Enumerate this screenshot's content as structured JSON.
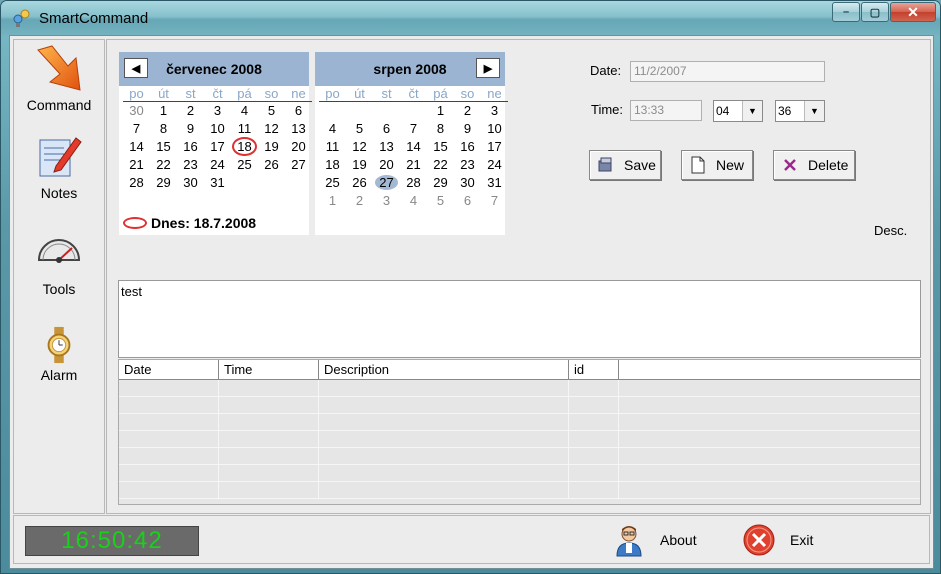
{
  "window": {
    "title": "SmartCommand",
    "minimize": "–",
    "maximize": "▢",
    "close": "✕"
  },
  "nav": [
    {
      "label": "Command",
      "icon": "arrow-icon"
    },
    {
      "label": "Notes",
      "icon": "notes-icon"
    },
    {
      "label": "Tools",
      "icon": "gauge-icon"
    },
    {
      "label": "Alarm",
      "icon": "watch-icon"
    }
  ],
  "calendar": {
    "prev": "◀",
    "next": "▶",
    "dow": [
      "po",
      "út",
      "st",
      "čt",
      "pá",
      "so",
      "ne"
    ],
    "left": {
      "title": "červenec 2008",
      "weeks": [
        [
          "30",
          "1",
          "2",
          "3",
          "4",
          "5",
          "6"
        ],
        [
          "7",
          "8",
          "9",
          "10",
          "11",
          "12",
          "13"
        ],
        [
          "14",
          "15",
          "16",
          "17",
          "18",
          "19",
          "20"
        ],
        [
          "21",
          "22",
          "23",
          "24",
          "25",
          "26",
          "27"
        ],
        [
          "28",
          "29",
          "30",
          "31",
          "",
          "",
          ""
        ]
      ],
      "today": "18"
    },
    "right": {
      "title": "srpen 2008",
      "weeks": [
        [
          "",
          "",
          "",
          "",
          "1",
          "2",
          "3"
        ],
        [
          "4",
          "5",
          "6",
          "7",
          "8",
          "9",
          "10"
        ],
        [
          "11",
          "12",
          "13",
          "14",
          "15",
          "16",
          "17"
        ],
        [
          "18",
          "19",
          "20",
          "21",
          "22",
          "23",
          "24"
        ],
        [
          "25",
          "26",
          "27",
          "28",
          "29",
          "30",
          "31"
        ],
        [
          "1",
          "2",
          "3",
          "4",
          "5",
          "6",
          "7"
        ]
      ],
      "selected": "27"
    },
    "today_label": "Dnes: 18.7.2008"
  },
  "form": {
    "date_label": "Date:",
    "date_value": "11/2/2007",
    "time_label": "Time:",
    "time_value": "13:33",
    "hour": "04",
    "minute": "36",
    "save": "Save",
    "new": "New",
    "delete": "Delete",
    "desc_label": "Desc.",
    "text": "test"
  },
  "table": {
    "columns": [
      "Date",
      "Time",
      "Description",
      "id",
      ""
    ],
    "rows": 7
  },
  "footer": {
    "clock": "16:50:42",
    "about": "About",
    "exit": "Exit"
  }
}
